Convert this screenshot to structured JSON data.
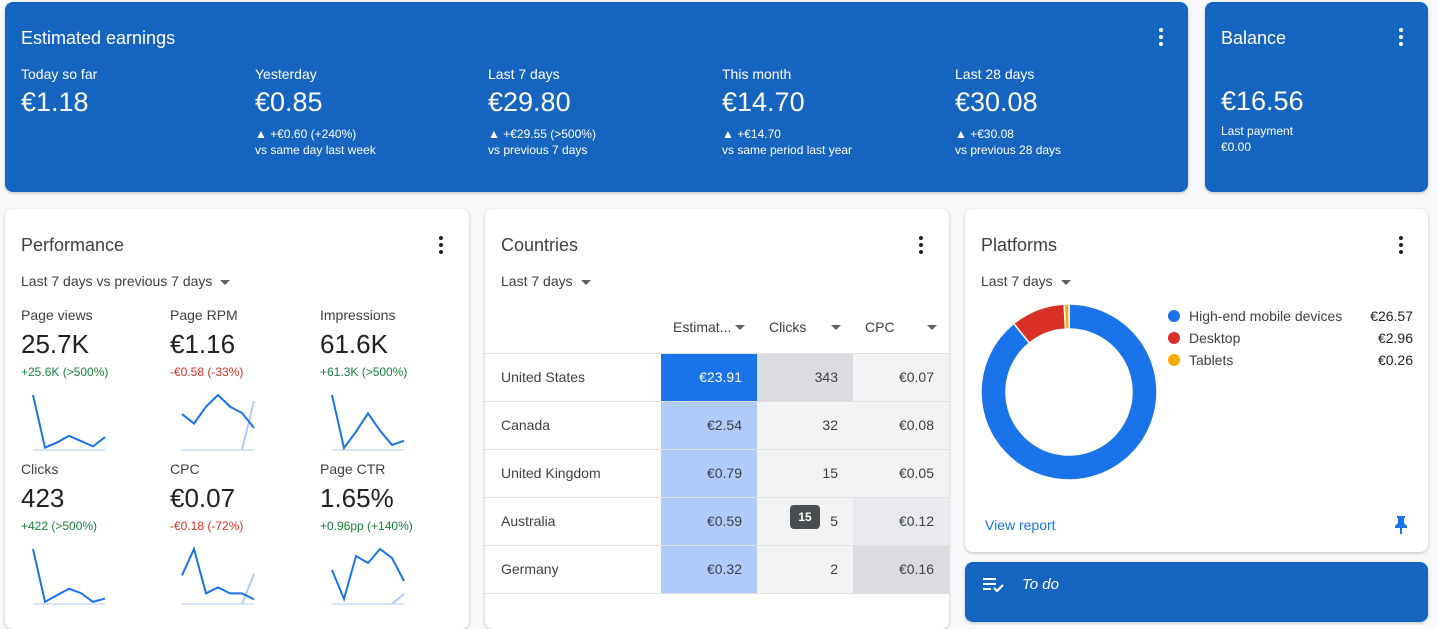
{
  "earnings": {
    "title": "Estimated earnings",
    "metrics": [
      {
        "label": "Today so far",
        "value": "€1.18"
      },
      {
        "label": "Yesterday",
        "value": "€0.85",
        "change": "▲ +€0.60 (+240%)",
        "compare": "vs same day last week"
      },
      {
        "label": "Last 7 days",
        "value": "€29.80",
        "change": "▲ +€29.55 (>500%)",
        "compare": "vs previous 7 days"
      },
      {
        "label": "This month",
        "value": "€14.70",
        "change": "▲ +€14.70",
        "compare": "vs same period last year"
      },
      {
        "label": "Last 28 days",
        "value": "€30.08",
        "change": "▲ +€30.08",
        "compare": "vs previous 28 days"
      }
    ]
  },
  "balance": {
    "title": "Balance",
    "value": "€16.56",
    "last_payment_label": "Last payment",
    "last_payment_value": "€0.00"
  },
  "performance": {
    "title": "Performance",
    "range": "Last 7 days vs previous 7 days",
    "metrics": [
      {
        "label": "Page views",
        "value": "25.7K",
        "change": "+25.6K (>500%)",
        "trend": "up",
        "series": [
          41,
          1,
          5,
          10,
          6,
          2,
          9
        ],
        "previous": []
      },
      {
        "label": "Page RPM",
        "value": "€1.16",
        "change": "-€0.58 (-33%)",
        "trend": "down",
        "series": [
          33,
          24,
          40,
          51,
          40,
          34,
          20
        ],
        "previous": [
          0,
          49
        ]
      },
      {
        "label": "Impressions",
        "value": "61.6K",
        "change": "+61.3K (>500%)",
        "trend": "up",
        "series": [
          53,
          1,
          17,
          35,
          18,
          4,
          8
        ],
        "previous": []
      },
      {
        "label": "Clicks",
        "value": "423",
        "change": "+422 (>500%)",
        "trend": "up",
        "series": [
          49,
          1,
          7,
          13,
          9,
          1,
          4
        ],
        "previous": []
      },
      {
        "label": "CPC",
        "value": "€0.07",
        "change": "-€0.18 (-72%)",
        "trend": "down",
        "series": [
          23,
          45,
          8,
          13,
          8,
          8,
          3
        ],
        "previous": [
          0,
          30
        ]
      },
      {
        "label": "Page CTR",
        "value": "1.65%",
        "change": "+0.96pp (+140%)",
        "trend": "up",
        "series": [
          33,
          4,
          47,
          40,
          54,
          45,
          22
        ],
        "previous": [
          0,
          10
        ]
      }
    ]
  },
  "countries": {
    "title": "Countries",
    "range": "Last 7 days",
    "columns": [
      "Estimat...",
      "Clicks",
      "CPC"
    ],
    "rows": [
      {
        "country": "United States",
        "earnings": "€23.91",
        "clicks": "343",
        "cpc": "€0.07"
      },
      {
        "country": "Canada",
        "earnings": "€2.54",
        "clicks": "32",
        "cpc": "€0.08"
      },
      {
        "country": "United Kingdom",
        "earnings": "€0.79",
        "clicks": "15",
        "cpc": "€0.05"
      },
      {
        "country": "Australia",
        "earnings": "€0.59",
        "clicks": "5",
        "cpc": "€0.12"
      },
      {
        "country": "Germany",
        "earnings": "€0.32",
        "clicks": "2",
        "cpc": "€0.16"
      }
    ],
    "tooltip": "15"
  },
  "platforms": {
    "title": "Platforms",
    "range": "Last 7 days",
    "items": [
      {
        "label": "High-end mobile devices",
        "value": "€26.57",
        "amount": 26.57,
        "color": "#1a73e8"
      },
      {
        "label": "Desktop",
        "value": "€2.96",
        "amount": 2.96,
        "color": "#d93025"
      },
      {
        "label": "Tablets",
        "value": "€0.26",
        "amount": 0.26,
        "color": "#f9ab00"
      }
    ],
    "view_report": "View report"
  },
  "todo": {
    "title": "To do"
  },
  "colors": {
    "brand": "#1565c0",
    "accent": "#1a73e8",
    "positive": "#188038",
    "negative": "#d93025"
  }
}
